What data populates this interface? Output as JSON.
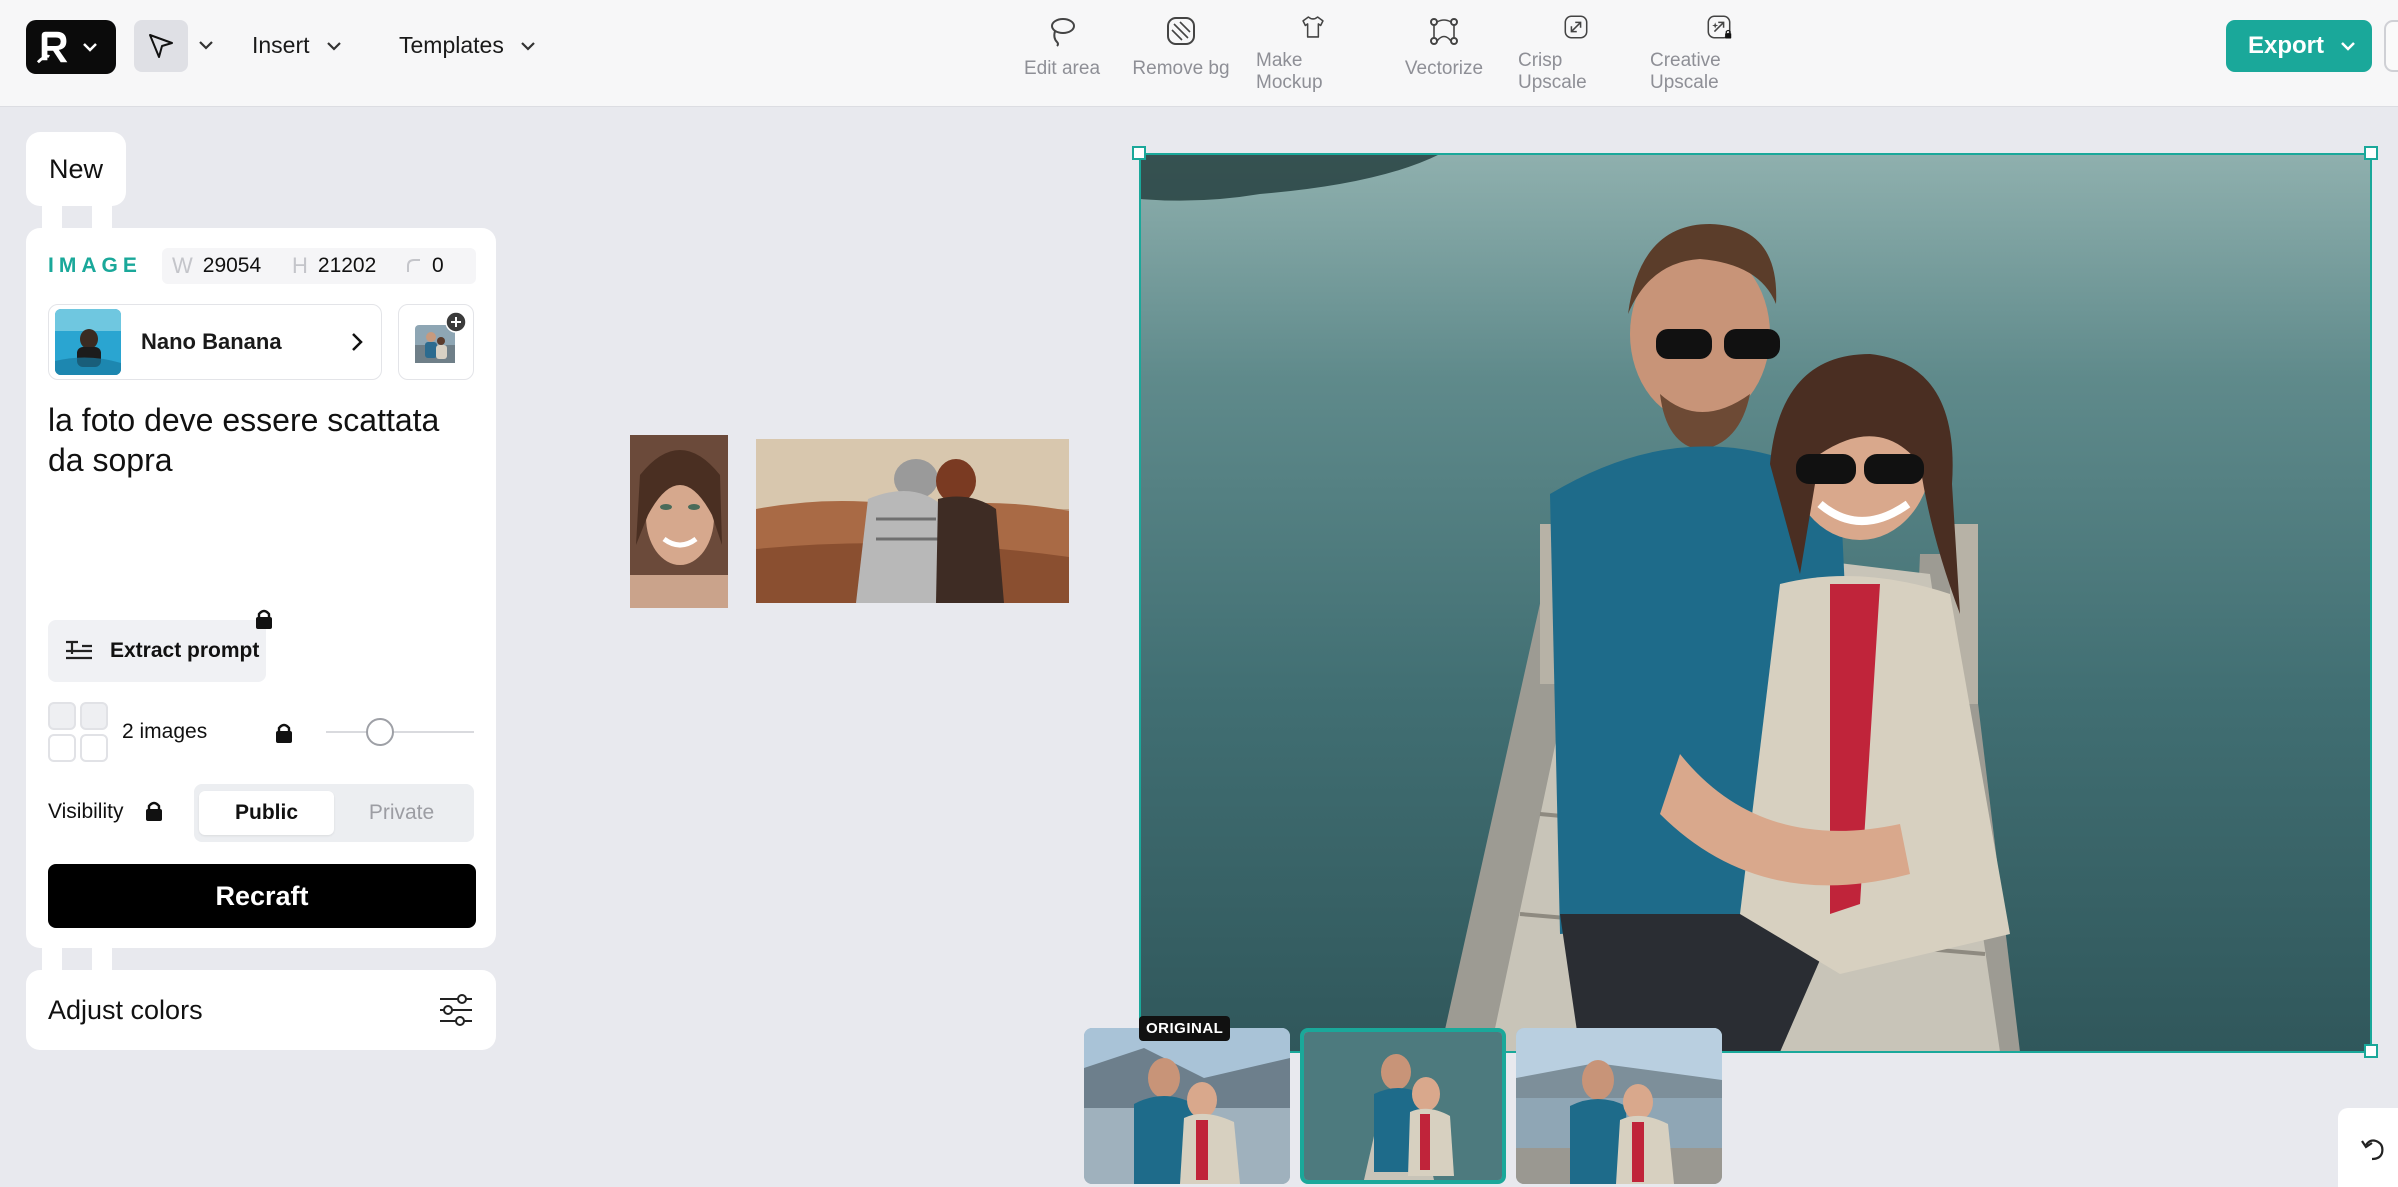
{
  "toolbar": {
    "insert_label": "Insert",
    "templates_label": "Templates",
    "actions": [
      {
        "label": "Edit area",
        "icon": "lasso-icon"
      },
      {
        "label": "Remove bg",
        "icon": "remove-bg-icon"
      },
      {
        "label": "Make Mockup",
        "icon": "tshirt-icon"
      },
      {
        "label": "Vectorize",
        "icon": "vector-nodes-icon"
      },
      {
        "label": "Crisp Upscale",
        "icon": "upscale-arrows-icon"
      },
      {
        "label": "Creative Upscale",
        "icon": "creative-upscale-icon"
      }
    ],
    "export_label": "Export"
  },
  "panel": {
    "tab_label": "New",
    "section_label": "IMAGE",
    "width_key": "W",
    "width_value": "29054",
    "height_key": "H",
    "height_value": "21202",
    "radius_value": "0",
    "model_name": "Nano Banana",
    "prompt": "la foto deve essere scattata da sopra",
    "extract_label": "Extract prompt",
    "images_count": "2 images",
    "visibility_label": "Visibility",
    "visibility_options": [
      "Public",
      "Private"
    ],
    "visibility_selected": "Public",
    "recraft_label": "Recraft",
    "adjust_label": "Adjust colors"
  },
  "canvas": {
    "original_badge": "ORIGINAL",
    "selected_variant": 1
  },
  "colors": {
    "accent": "#1aa89a",
    "background": "#e8e9ee"
  }
}
